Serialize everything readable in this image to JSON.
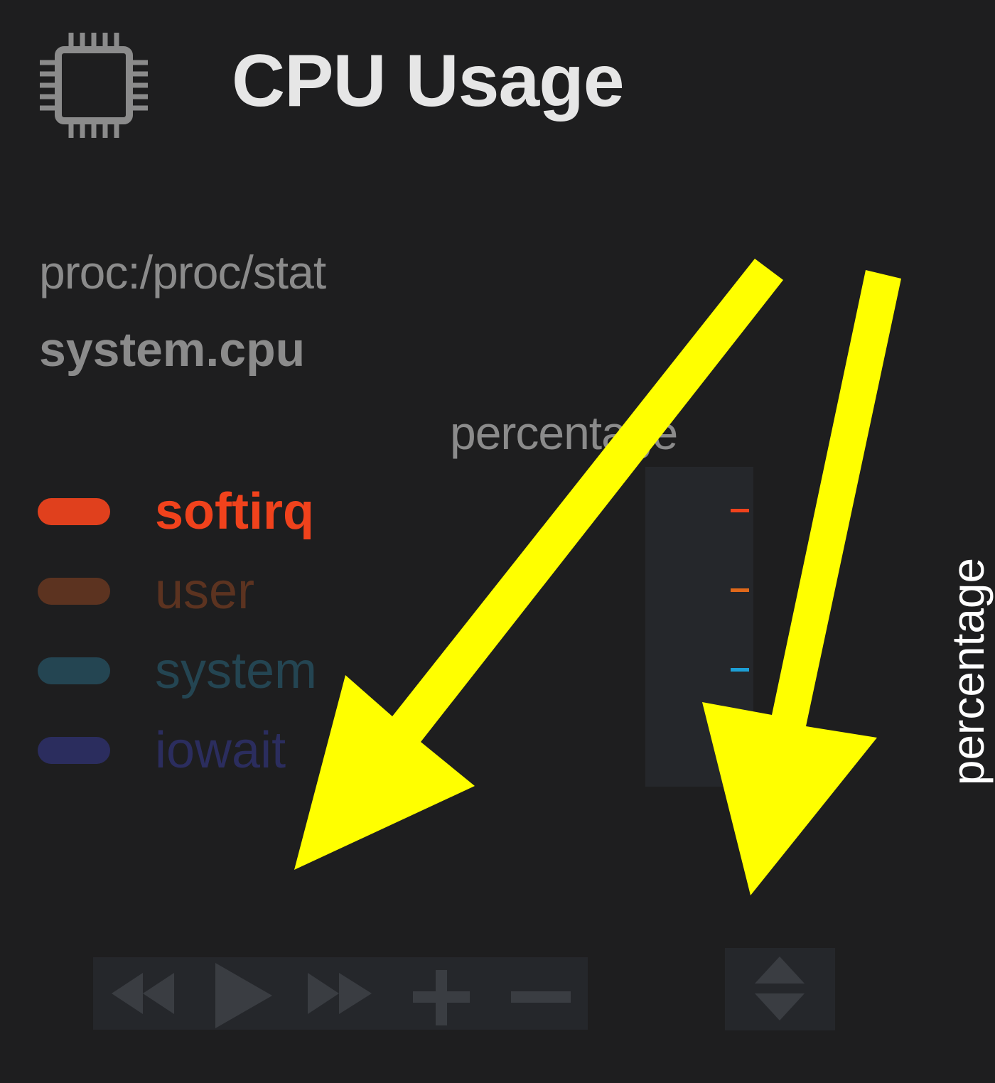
{
  "header": {
    "title": "CPU Usage",
    "icon": "cpu-chip-icon"
  },
  "info": {
    "source": "proc:/proc/stat",
    "context": "system.cpu",
    "units": "percentage"
  },
  "legend": {
    "items": [
      {
        "label": "softirq",
        "color": "#f0421c",
        "swatch_color": "#e0401d",
        "value_color": "#f0421c"
      },
      {
        "label": "user",
        "color": "#5c3320",
        "swatch_color": "#5c3320",
        "value_color": "#e0681a"
      },
      {
        "label": "system",
        "color": "#244552",
        "swatch_color": "#244552",
        "value_color": "#1d9fd6"
      },
      {
        "label": "iowait",
        "color": "#2b2d5e",
        "swatch_color": "#2b2d5e",
        "value_color": ""
      }
    ]
  },
  "y_axis": {
    "label": "percentage"
  },
  "toolbar": {
    "buttons": [
      {
        "name": "pan-left",
        "icon": "rewind-icon"
      },
      {
        "name": "play",
        "icon": "play-icon"
      },
      {
        "name": "pan-right",
        "icon": "fast-forward-icon"
      },
      {
        "name": "zoom-in",
        "icon": "plus-icon"
      },
      {
        "name": "zoom-out",
        "icon": "minus-icon"
      }
    ],
    "resize_icon": "resize-updown-icon"
  },
  "colors": {
    "background": "#1e1e1f",
    "panel": "#25272b",
    "toolbar_icon": "#3a3d42",
    "annotation_arrow": "#ffff00"
  }
}
